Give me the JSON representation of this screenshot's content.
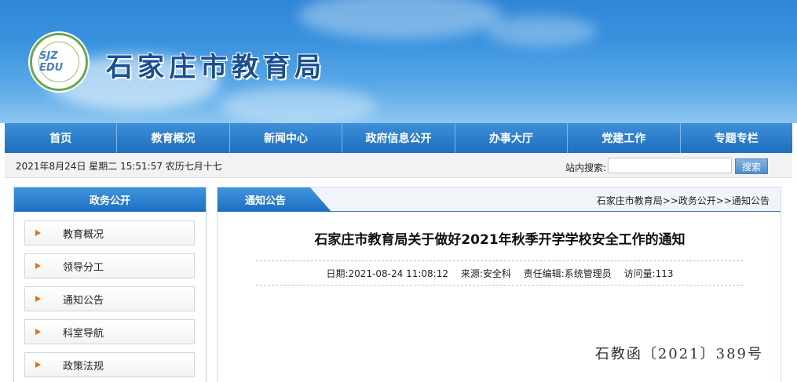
{
  "header": {
    "site_title": "石家庄市教育局",
    "logo_text": "SJZ EDU"
  },
  "nav": {
    "items": [
      "首页",
      "教育概况",
      "新闻中心",
      "政府信息公开",
      "办事大厅",
      "党建工作",
      "专题专栏"
    ]
  },
  "infobar": {
    "datetime": "2021年8月24日 星期二 15:51:57 农历七月十七",
    "search_label": "站内搜索:",
    "search_value": "",
    "search_button": "搜索"
  },
  "sidebar": {
    "title": "政务公开",
    "items": [
      "教育概况",
      "领导分工",
      "通知公告",
      "科室导航",
      "政策法规"
    ]
  },
  "main": {
    "tab": "通知公告",
    "breadcrumb": "石家庄市教育局>>政务公开>>通知公告",
    "title": "石家庄市教育局关于做好2021年秋季开学学校安全工作的通知",
    "meta": {
      "date": "日期:2021-08-24 11:08:12",
      "source": "来源:安全科",
      "editor": "责任编辑:系统管理员",
      "visits": "访问量:113"
    },
    "doc_number": "石教函〔2021〕389号"
  },
  "colors": {
    "nav_blue": "#1d6fc0",
    "banner_blue": "#3a93df",
    "arrow_orange": "#e0731c"
  }
}
